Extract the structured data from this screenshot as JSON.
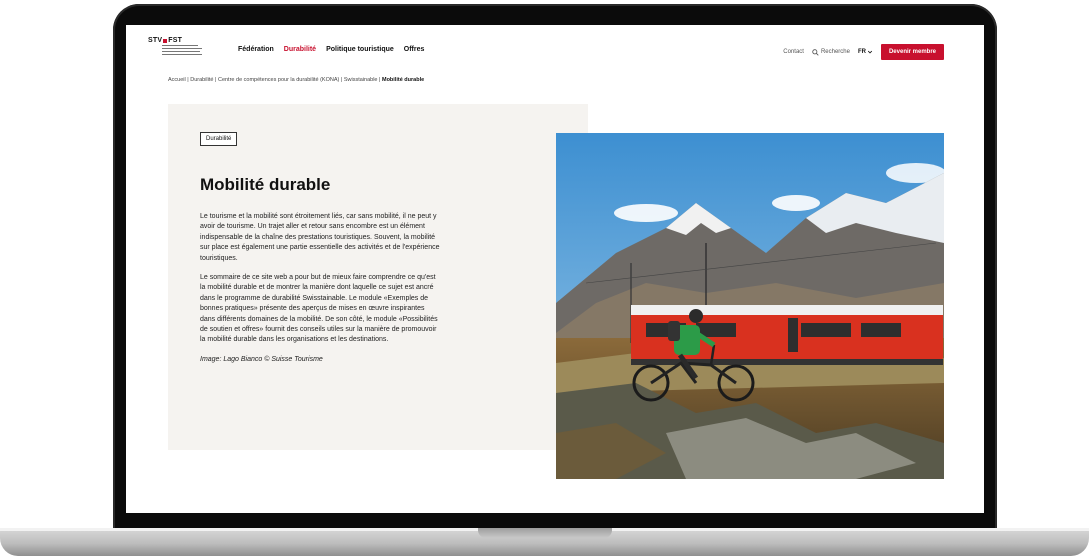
{
  "header": {
    "logo_text_left": "STV",
    "logo_text_right": "FST",
    "nav": [
      "Fédération",
      "Durabilité",
      "Politique touristique",
      "Offres"
    ],
    "active_nav_index": 1,
    "contact": "Contact",
    "search": "Recherche",
    "language": "FR",
    "cta": "Devenir membre"
  },
  "breadcrumb": {
    "items": [
      "Accueil",
      "Durabilité",
      "Centre de compétences pour la durabilité (KONA)",
      "Swisstainable"
    ],
    "current": "Mobilité durable"
  },
  "content": {
    "tag": "Durabilité",
    "title": "Mobilité durable",
    "paragraph1": "Le tourisme et la mobilité sont étroitement liés, car sans mobilité, il ne peut y avoir de tourisme. Un trajet aller et retour sans encombre est un élément indispensable de la chaîne des prestations touristiques. Souvent, la mobilité sur place est également une partie essentielle des activités et de l'expérience touristiques.",
    "paragraph2": "Le sommaire de ce site web a pour but de mieux faire comprendre ce qu'est la mobilité durable et de montrer la manière dont laquelle ce sujet est ancré dans le programme de durabilité Swisstainable. Le module «Exemples de bonnes pratiques» présente des aperçus de mises en œuvre inspirantes dans différents domaines de la mobilité. De son côté, le module «Possibilités de soutien et offres» fournit des conseils utiles sur la manière de promouvoir la mobilité durable dans les organisations et les destinations.",
    "caption": "Image: Lago Bianco © Suisse Tourisme"
  },
  "colors": {
    "brand_red": "#c8102e",
    "panel_bg": "#f5f3f0",
    "train_red": "#d9311f"
  },
  "icons": [
    "search-icon",
    "chevron-down-icon"
  ]
}
